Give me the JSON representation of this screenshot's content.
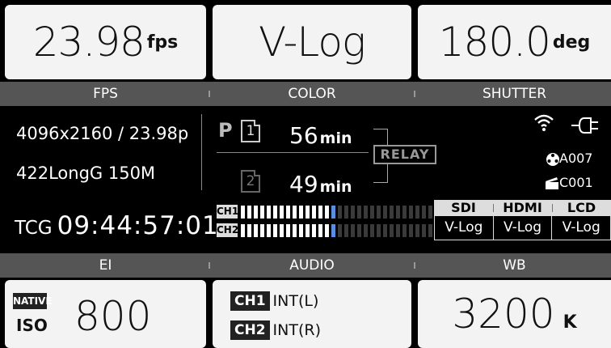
{
  "top_tiles": {
    "fps": {
      "value": "23.98",
      "unit": "fps"
    },
    "color": {
      "value": "V-Log"
    },
    "shutter": {
      "value": "180.0",
      "unit": "deg"
    }
  },
  "top_labels": {
    "fps": "FPS",
    "color": "COLOR",
    "shutter": "SHUTTER"
  },
  "info": {
    "resolution": "4096x2160 / 23.98p",
    "codec": "422LongG 150M",
    "tc_label": "TCG",
    "timecode": "09:44:57:01"
  },
  "media": {
    "p_label": "P",
    "slot1": {
      "num": "1",
      "time": "56",
      "unit": "min"
    },
    "slot2": {
      "num": "2",
      "time": "49",
      "unit": "min"
    },
    "relay": "RELAY"
  },
  "status": {
    "clip_a": "A007",
    "clip_c": "C001",
    "icons": [
      "wifi-icon",
      "power-plug-icon",
      "reel-icon",
      "clapper-icon"
    ]
  },
  "audio_meters": {
    "ch1_label": "CH1",
    "ch2_label": "CH2",
    "ch1_level": 0.5,
    "ch2_level": 0.5
  },
  "outputs": {
    "headers": [
      "SDI",
      "HDMI",
      "LCD"
    ],
    "values": [
      "V-Log",
      "V-Log",
      "V-Log"
    ]
  },
  "bottom_labels": {
    "ei": "EI",
    "audio": "AUDIO",
    "wb": "WB"
  },
  "bottom_tiles": {
    "ei": {
      "native": "NATIVE",
      "iso": "ISO",
      "value": "800"
    },
    "audio": {
      "ch1": {
        "label": "CH1",
        "input": "INT(L)"
      },
      "ch2": {
        "label": "CH2",
        "input": "INT(R)"
      }
    },
    "wb": {
      "value": "3200",
      "unit": "K"
    }
  }
}
